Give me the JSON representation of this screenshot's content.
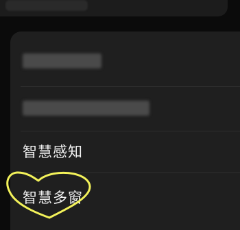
{
  "settings_list": {
    "items": [
      {
        "label": ""
      },
      {
        "label": ""
      },
      {
        "label": "智慧感知"
      },
      {
        "label": "智慧多窗"
      }
    ]
  },
  "colors": {
    "background": "#0b0b0b",
    "card": "#1f1f1f",
    "text": "#f2f2f2",
    "highlight_heart": "#f3f25a"
  },
  "icons": {
    "annotation": "heart-outline-icon"
  }
}
